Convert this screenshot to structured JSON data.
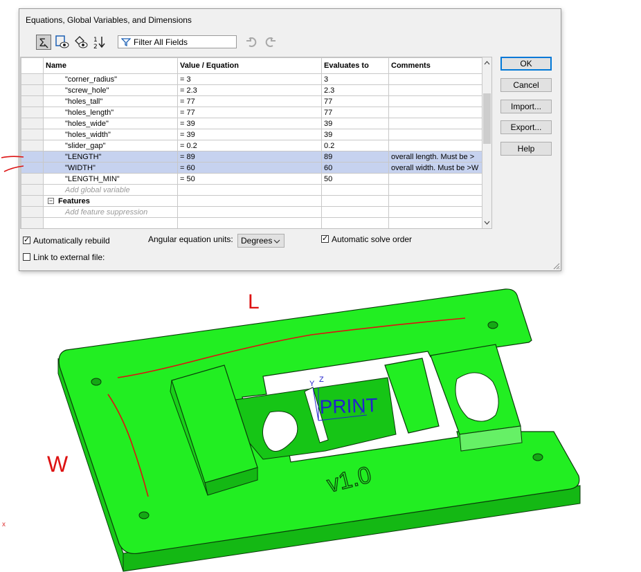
{
  "dialog": {
    "title": "Equations, Global Variables, and Dimensions",
    "filter_placeholder": "Filter All Fields",
    "toolbar_icons": [
      "equation-view-icon",
      "sketch-equation-view-icon",
      "dimension-view-icon",
      "ordered-view-icon"
    ],
    "columns": [
      "Name",
      "Value / Equation",
      "Evaluates to",
      "Comments"
    ],
    "rows": [
      {
        "name": "\"corner_radius\"",
        "value": "= 3",
        "evaluates": "3",
        "comment": "",
        "selected": false
      },
      {
        "name": "\"screw_hole\"",
        "value": "= 2.3",
        "evaluates": "2.3",
        "comment": "",
        "selected": false
      },
      {
        "name": "\"holes_tall\"",
        "value": "= 77",
        "evaluates": "77",
        "comment": "",
        "selected": false
      },
      {
        "name": "\"holes_length\"",
        "value": "= 77",
        "evaluates": "77",
        "comment": "",
        "selected": false
      },
      {
        "name": "\"holes_wide\"",
        "value": "= 39",
        "evaluates": "39",
        "comment": "",
        "selected": false
      },
      {
        "name": "\"holes_width\"",
        "value": "= 39",
        "evaluates": "39",
        "comment": "",
        "selected": false
      },
      {
        "name": "\"slider_gap\"",
        "value": "= 0.2",
        "evaluates": "0.2",
        "comment": "",
        "selected": false
      },
      {
        "name": "\"LENGTH\"",
        "value": "= 89",
        "evaluates": "89",
        "comment": "overall length.  Must be >",
        "selected": true
      },
      {
        "name": "\"WIDTH\"",
        "value": "= 60",
        "evaluates": "60",
        "comment": "overall width. Must be >W",
        "selected": true
      },
      {
        "name": "\"LENGTH_MIN\"",
        "value": "= 50",
        "evaluates": "50",
        "comment": "",
        "selected": false
      }
    ],
    "add_global_variable": "Add global variable",
    "features_section": "Features",
    "add_feature_suppression": "Add feature suppression",
    "buttons": {
      "ok": "OK",
      "cancel": "Cancel",
      "import": "Import...",
      "export": "Export...",
      "help": "Help"
    },
    "auto_rebuild_label": "Automatically rebuild",
    "auto_rebuild_checked": true,
    "angular_units_label": "Angular equation units:",
    "angular_units_value": "Degrees",
    "auto_solve_label": "Automatic solve order",
    "auto_solve_checked": true,
    "link_external_label": "Link to external file:",
    "link_external_checked": false
  },
  "model": {
    "print_text": "PRINT",
    "version_text": "v1.0",
    "annotation_length": "L",
    "annotation_width": "W",
    "axis_x": "X",
    "axis_y": "Y",
    "axis_z": "Z",
    "origin_mark": "x",
    "model_color": "#22ee22",
    "annotation_color": "#dd1111"
  }
}
